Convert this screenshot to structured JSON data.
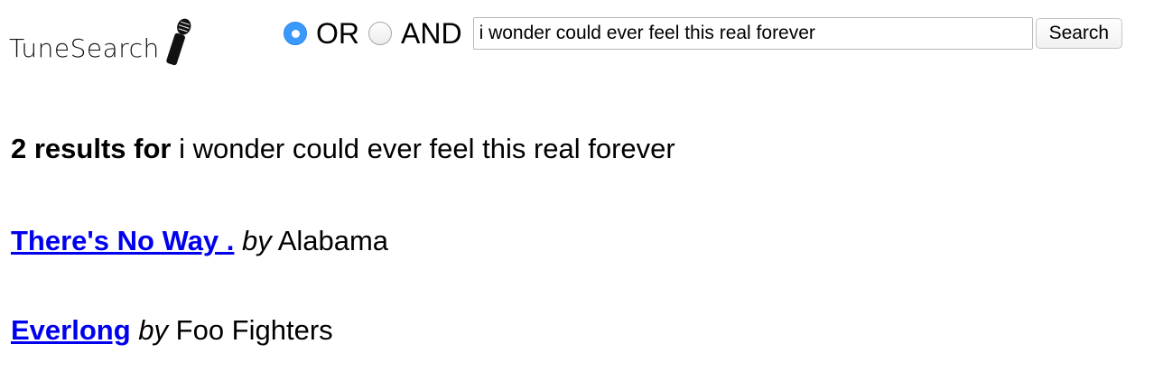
{
  "logo": {
    "text": "TuneSearch",
    "icon": "microphone-icon"
  },
  "search": {
    "options": [
      {
        "label": "OR",
        "selected": true
      },
      {
        "label": "AND",
        "selected": false
      }
    ],
    "query": "i wonder could ever feel this real forever",
    "button_label": "Search"
  },
  "results": {
    "count_label": "2 results for",
    "query": "i wonder could ever feel this real forever",
    "items": [
      {
        "title": "There's No Way .",
        "by_label": "by",
        "artist": "Alabama"
      },
      {
        "title": "Everlong",
        "by_label": "by",
        "artist": "Foo Fighters"
      }
    ]
  },
  "colors": {
    "link": "#0000ee",
    "radio_selected": "#3b99fc"
  }
}
